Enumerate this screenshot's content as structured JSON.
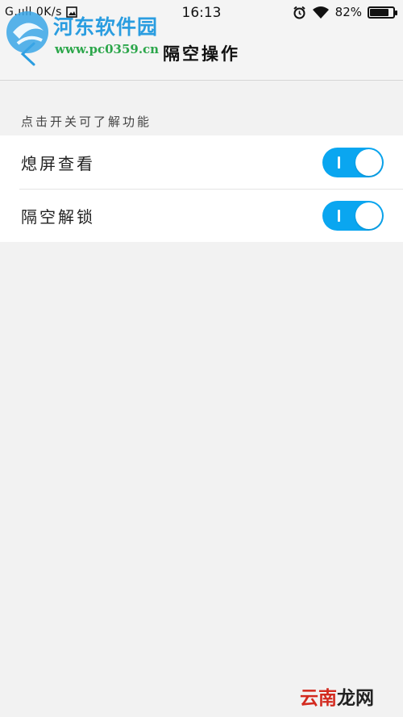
{
  "status_bar": {
    "carrier_signal": "G.ııll",
    "speed": "0K/s",
    "time": "16:13",
    "battery": "82%",
    "battery_level": 0.82,
    "icons": [
      "signal-icon",
      "image-icon",
      "alarm-icon",
      "wifi-icon",
      "battery-icon"
    ]
  },
  "header": {
    "title": "隔空操作",
    "back_icon": "chevron-left-icon"
  },
  "watermark": {
    "name": "河东软件园",
    "url": "www.pc0359.cn"
  },
  "section": {
    "label": "点击开关可了解功能"
  },
  "settings": [
    {
      "label": "熄屏查看",
      "enabled": true
    },
    {
      "label": "隔空解锁",
      "enabled": true
    }
  ],
  "footer_watermark": {
    "part1": "云南",
    "part2": "龙网"
  },
  "colors": {
    "accent": "#0aa6f0",
    "background": "#f2f2f2",
    "watermark_blue": "#2a9de0",
    "watermark_green": "#2ba64a",
    "footer_red": "#d32a1f"
  }
}
